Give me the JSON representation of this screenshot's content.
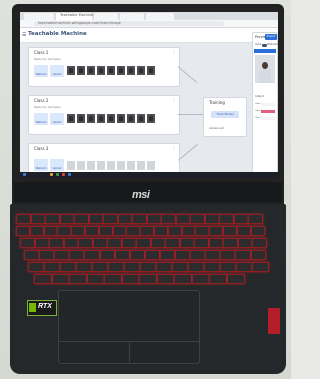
{
  "browser": {
    "tabs": [
      "",
      "Teachable Machine",
      "",
      "",
      ""
    ],
    "url": "teachablemachine.withgoogle.com/train/image"
  },
  "app": {
    "title": "Teachable Machine",
    "classes": [
      {
        "name": "Class 1",
        "samples_label": "Webcam Samples",
        "thumbs": 9,
        "filled": true
      },
      {
        "name": "Class 2",
        "samples_label": "Webcam Samples",
        "thumbs": 9,
        "filled": true
      },
      {
        "name": "Class 3",
        "samples_label": "",
        "thumbs": 9,
        "filled": false
      }
    ],
    "buttons": {
      "webcam": "Webcam",
      "upload": "Upload"
    },
    "training": {
      "title": "Training",
      "button": "Train Model",
      "advanced": "Advanced"
    },
    "preview": {
      "title": "Preview",
      "export": "Export",
      "input_label": "Input",
      "input_state": "ON",
      "source": "Webcam",
      "output_label": "Output",
      "outputs": [
        {
          "label": "Class 1",
          "value": 0.0,
          "color": "#e9a46a"
        },
        {
          "label": "Class 2",
          "value": 1.0,
          "color": "#e2607e"
        },
        {
          "label": "Class 3",
          "value": 0.0,
          "color": "#a98ad9"
        }
      ]
    }
  },
  "laptop": {
    "brand": "msi",
    "sticker": "RTX"
  },
  "colors": {
    "accent": "#2d6fd8",
    "keyboard_backlight": "#b32228",
    "nvidia_green": "#76b900"
  }
}
